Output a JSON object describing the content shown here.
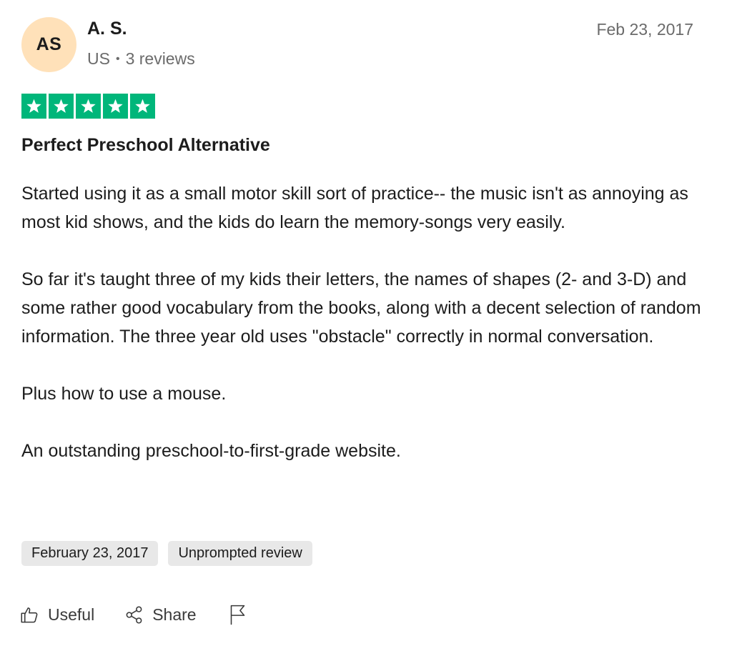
{
  "reviewer": {
    "initials": "AS",
    "name": "A. S.",
    "country": "US",
    "separator": "•",
    "review_count": "3 reviews",
    "avatar_color": "#ffe1b9"
  },
  "review": {
    "date_short": "Feb 23, 2017",
    "rating": 5,
    "rating_max": 5,
    "star_color": "#00b67a",
    "title": "Perfect Preschool Alternative",
    "paragraphs": [
      "Started using it as a small motor skill sort of practice-- the music isn't as annoying as most kid shows, and the kids do learn the memory-songs very easily.",
      "So far it's taught three of my kids their letters, the names of shapes (2- and 3-D) and some rather good vocabulary from the books, along with a decent selection of random information. The three year old uses \"obstacle\" correctly in normal conversation.",
      "Plus how to use a mouse.",
      "An outstanding preschool-to-first-grade website."
    ],
    "tags": [
      "February 23, 2017",
      "Unprompted review"
    ]
  },
  "actions": {
    "useful_label": "Useful",
    "share_label": "Share",
    "useful_icon": "thumbs-up-icon",
    "share_icon": "share-icon",
    "report_icon": "flag-icon"
  }
}
